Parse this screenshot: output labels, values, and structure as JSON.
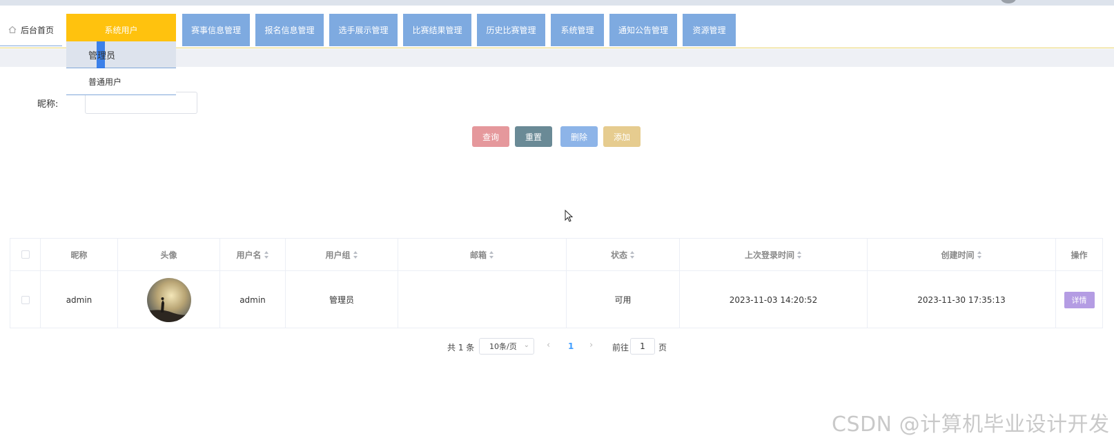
{
  "nav": {
    "home_label": "后台首页",
    "menu": [
      {
        "label": "系统用户",
        "active": true
      },
      {
        "label": "赛事信息管理"
      },
      {
        "label": "报名信息管理"
      },
      {
        "label": "选手展示管理"
      },
      {
        "label": "比赛结果管理"
      },
      {
        "label": "历史比赛管理"
      },
      {
        "label": "系统管理"
      },
      {
        "label": "通知公告管理"
      },
      {
        "label": "资源管理"
      }
    ],
    "dropdown": [
      "管理员",
      "普通用户"
    ]
  },
  "search": {
    "label": "昵称:",
    "value": ""
  },
  "buttons": {
    "query": "查询",
    "reset": "重置",
    "delete": "删除",
    "add": "添加"
  },
  "table": {
    "headers": [
      "昵称",
      "头像",
      "用户名",
      "用户组",
      "邮箱",
      "状态",
      "上次登录时间",
      "创建时间",
      "操作"
    ],
    "rows": [
      {
        "nickname": "admin",
        "username": "admin",
        "group": "管理员",
        "email": "",
        "status": "可用",
        "last_login": "2023-11-03 14:20:52",
        "created": "2023-11-30 17:35:13",
        "action": "详情"
      }
    ]
  },
  "pagination": {
    "total": "共 1 条",
    "page_size": "10条/页",
    "current": "1",
    "goto_label": "前往",
    "goto_value": "1",
    "page_unit": "页"
  },
  "watermark": "CSDN @计算机毕业设计开发",
  "colors": {
    "menu": "#7eaae0",
    "active": "#ffc20e",
    "query": "#e5989c",
    "reset": "#6a8a96",
    "delete": "#8db4e8",
    "add": "#e6cc8f",
    "detail": "#b49ce3"
  }
}
